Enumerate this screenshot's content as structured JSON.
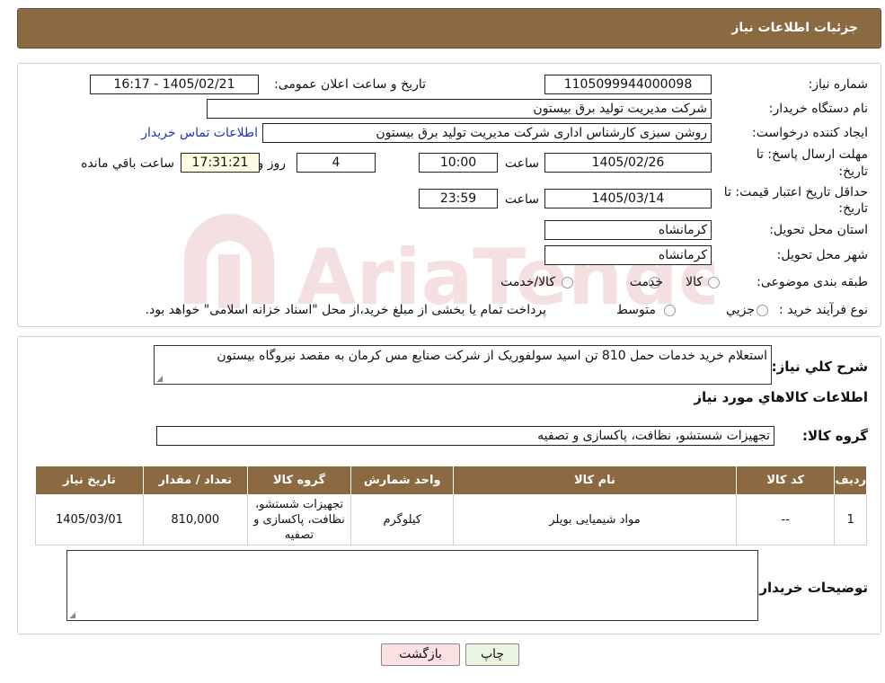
{
  "header": {
    "title": "جزئیات اطلاعات نیاز"
  },
  "form": {
    "need_number_label": "شماره نیاز:",
    "need_number": "1105099944000098",
    "announce_label": "تاریخ و ساعت اعلان عمومی:",
    "announce_value": "1405/02/21 - 16:17",
    "buyer_org_label": "نام دستگاه خریدار:",
    "buyer_org": "شرکت مدیریت تولید برق بیستون",
    "requester_label": "ایجاد کننده درخواست:",
    "requester": "روشن سبزی کارشناس اداری شرکت مدیریت تولید برق بیستون",
    "contact_link": "اطلاعات تماس خریدار",
    "deadline_label_1": "مهلت ارسال پاسخ: تا",
    "deadline_label_2": "تاریخ:",
    "deadline_date": "1405/02/26",
    "time_label": "ساعت",
    "deadline_time": "10:00",
    "days_value": "4",
    "days_label": "روز و",
    "remaining_time": "17:31:21",
    "remaining_label": "ساعت باقي مانده",
    "validity_label_1": "حداقل تاریخ اعتبار قیمت: تا",
    "validity_label_2": "تاریخ:",
    "validity_date": "1405/03/14",
    "validity_time": "23:59",
    "province_label": "استان محل تحویل:",
    "province": "کرمانشاه",
    "city_label": "شهر محل تحویل:",
    "city": "کرمانشاه",
    "category_label": "طبقه بندی موضوعی:",
    "category_options": [
      "کالا",
      "خدمت",
      "کالا/خدمت"
    ],
    "process_label": "نوع فرآیند خرید :",
    "process_options": [
      "جزیي",
      "متوسط"
    ],
    "process_note": "پرداخت تمام یا بخشی از مبلغ خرید،از محل \"اسناد خزانه اسلامی\" خواهد بود."
  },
  "summary": {
    "description_label": "شرح کلي نیاز:",
    "description": "استعلام خرید خدمات حمل 810 تن اسید سولفوریک از شرکت صنایع مس کرمان به مقصد نیروگاه بیستون",
    "goods_info_title": "اطلاعات کالاهاي مورد نیاز",
    "goods_group_label": "گروه کالا:",
    "goods_group": "تجهیزات شستشو، نظافت، پاکسازی و تصفیه"
  },
  "table": {
    "headers": [
      "ردیف",
      "کد کالا",
      "نام کالا",
      "واحد شمارش",
      "گروه کالا",
      "تعداد / مقدار",
      "تاریخ نیاز"
    ],
    "rows": [
      [
        "1",
        "--",
        "مواد شیمیایی بویلر",
        "کیلوگرم",
        "تجهیزات شستشو، نظافت، پاکسازی و تصفیه",
        "810,000",
        "1405/03/01"
      ]
    ]
  },
  "notes": {
    "label": "توضیحات خریدار:",
    "value": ""
  },
  "buttons": {
    "print": "چاپ",
    "back": "بازگشت"
  },
  "watermark": {
    "text": "AriaTender.neT"
  }
}
